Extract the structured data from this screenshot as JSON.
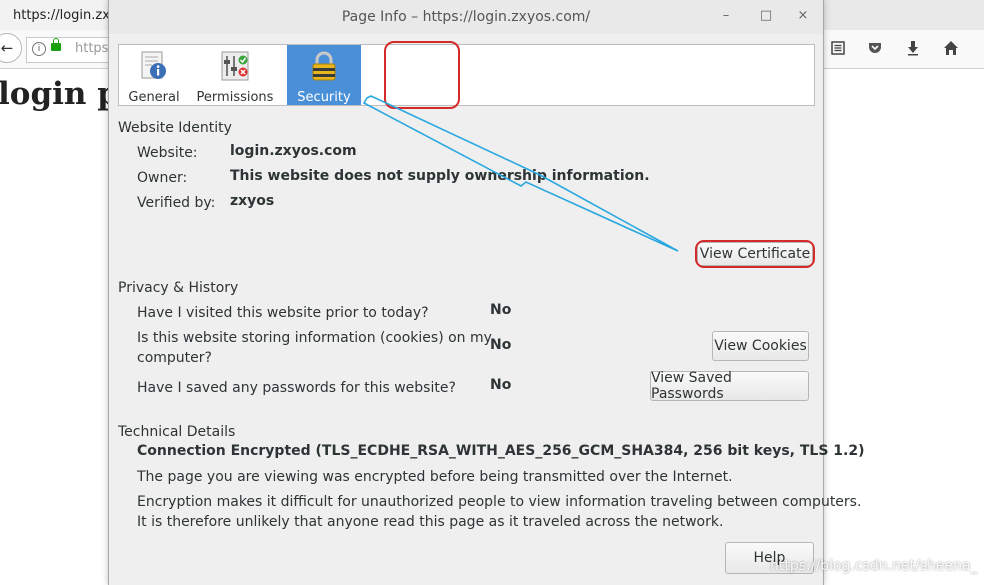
{
  "browser": {
    "tab_title": "https://login.zx",
    "url_text": "https",
    "page_heading": "login p",
    "back_glyph": "←",
    "info_glyph": "i",
    "toolbar_icons": [
      "reader-view-icon",
      "pocket-icon",
      "download-icon",
      "home-icon"
    ]
  },
  "dialog": {
    "title": "Page Info – https://login.zxyos.com/",
    "controls": {
      "minimize": "–",
      "maximize": "□",
      "close": "×"
    },
    "tabs": [
      {
        "label": "General",
        "icon": "general-info-icon"
      },
      {
        "label": "Permissions",
        "icon": "permissions-icon"
      },
      {
        "label": "Security",
        "icon": "padlock-icon",
        "active": true
      }
    ],
    "identity": {
      "heading": "Website Identity",
      "website_label": "Website:",
      "website_value": "login.zxyos.com",
      "owner_label": "Owner:",
      "owner_value": "This website does not supply ownership information.",
      "verified_label": "Verified by:",
      "verified_value": "zxyos",
      "view_certificate": "View Certificate"
    },
    "privacy": {
      "heading": "Privacy & History",
      "q1": "Have I visited this website prior to today?",
      "a1": "No",
      "q2_line1": "Is this website storing information (cookies) on my",
      "q2_line2": "computer?",
      "a2": "No",
      "q3": "Have I saved any passwords for this website?",
      "a3": "No",
      "view_cookies": "View Cookies",
      "view_saved_passwords": "View Saved Passwords"
    },
    "technical": {
      "heading": "Technical Details",
      "connection": "Connection Encrypted (TLS_ECDHE_RSA_WITH_AES_256_GCM_SHA384, 256 bit keys, TLS 1.2)",
      "para1": "The page you are viewing was encrypted before being transmitted over the Internet.",
      "para2_line1": "Encryption makes it difficult for unauthorized people to view information traveling between computers.",
      "para2_line2": "It is therefore unlikely that anyone read this page as it traveled across the network."
    },
    "help": "Help"
  },
  "watermark": "https://blog.csdn.net/sheena_",
  "colors": {
    "active_tab": "#4a90d9",
    "highlight": "#d32a2a",
    "annotation_arrow": "#29a8e0"
  }
}
